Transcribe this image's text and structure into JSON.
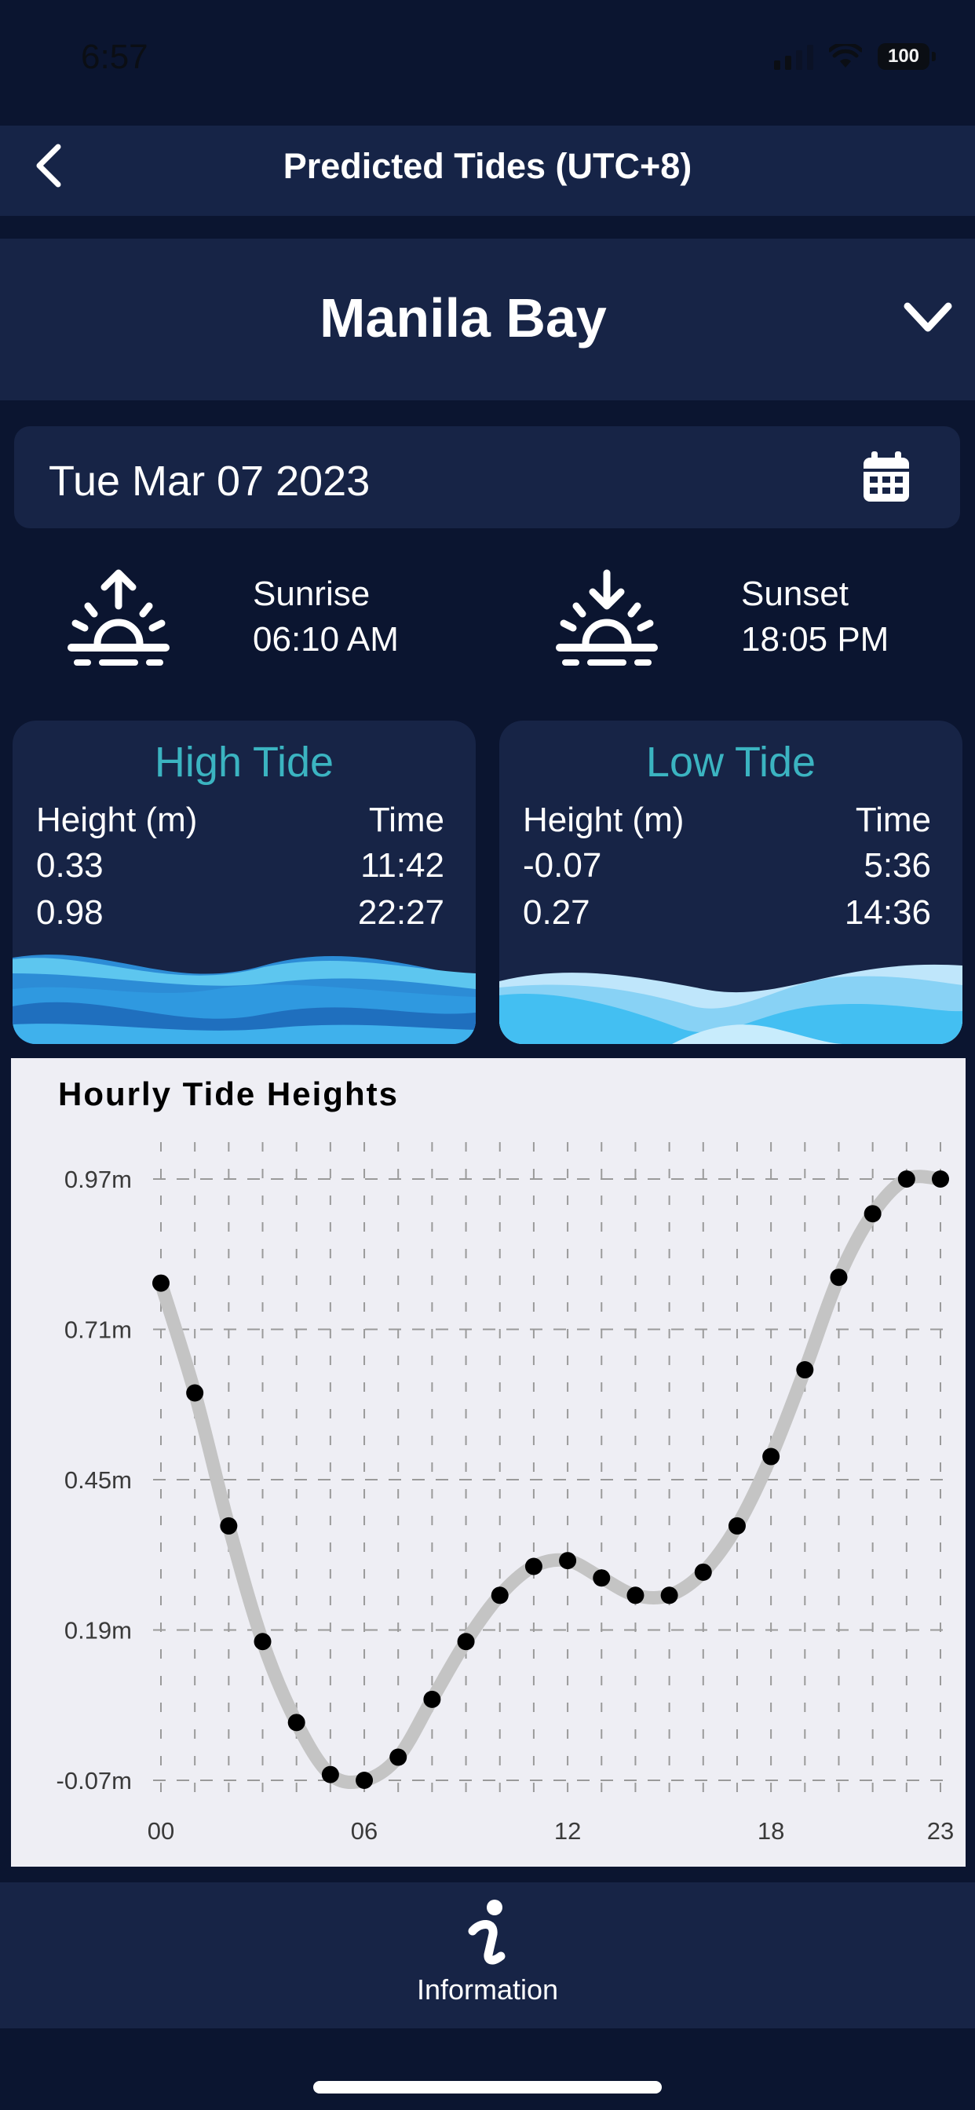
{
  "status_bar": {
    "time": "6:57",
    "battery": "100"
  },
  "nav": {
    "title": "Predicted Tides (UTC+8)"
  },
  "location": {
    "name": "Manila Bay"
  },
  "date": {
    "value": "Tue Mar 07 2023"
  },
  "sun": {
    "sunrise_label": "Sunrise",
    "sunrise_time": "06:10 AM",
    "sunset_label": "Sunset",
    "sunset_time": "18:05 PM"
  },
  "high_tide": {
    "title": "High Tide",
    "height_header": "Height (m)",
    "time_header": "Time",
    "rows": [
      {
        "height": "0.33",
        "time": "11:42"
      },
      {
        "height": "0.98",
        "time": "22:27"
      }
    ]
  },
  "low_tide": {
    "title": "Low Tide",
    "height_header": "Height (m)",
    "time_header": "Time",
    "rows": [
      {
        "height": "-0.07",
        "time": "5:36"
      },
      {
        "height": "0.27",
        "time": "14:36"
      }
    ]
  },
  "chart_data": {
    "type": "line",
    "title": "Hourly Tide Heights",
    "x": [
      0,
      1,
      2,
      3,
      4,
      5,
      6,
      7,
      8,
      9,
      10,
      11,
      12,
      13,
      14,
      15,
      16,
      17,
      18,
      19,
      20,
      21,
      22,
      23
    ],
    "values": [
      0.79,
      0.6,
      0.37,
      0.17,
      0.03,
      -0.06,
      -0.07,
      -0.03,
      0.07,
      0.17,
      0.25,
      0.3,
      0.31,
      0.28,
      0.25,
      0.25,
      0.29,
      0.37,
      0.49,
      0.64,
      0.8,
      0.91,
      0.97,
      0.97
    ],
    "y_ticks": [
      "0.97m",
      "0.71m",
      "0.45m",
      "0.19m",
      "-0.07m"
    ],
    "y_tick_values": [
      0.97,
      0.71,
      0.45,
      0.19,
      -0.07
    ],
    "x_ticks": [
      "00",
      "06",
      "12",
      "18",
      "23"
    ],
    "x_tick_values": [
      0,
      6,
      12,
      18,
      23
    ],
    "ylim": [
      -0.07,
      0.97
    ],
    "grid": true,
    "colors": {
      "line": "#c4c4c4",
      "point": "#000000"
    }
  },
  "tab_bar": {
    "info_label": "Information"
  },
  "colors": {
    "background": "#0b1530",
    "panel": "#172446",
    "accent": "#3bb4c1"
  }
}
